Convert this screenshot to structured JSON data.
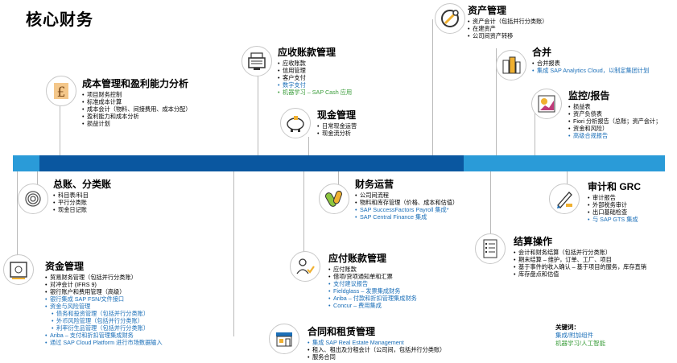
{
  "title": "核心财务",
  "modules": {
    "cost": {
      "title": "成本管理和盈利能力分析",
      "icon": "pound-icon",
      "items": [
        "项目财务控制",
        "标准成本计算",
        "成本会计（物料、间接费用、成本分配）",
        "盈利能力和成本分析",
        "损益计划"
      ]
    },
    "ar": {
      "title": "应收账款管理",
      "icon": "cash-register-icon",
      "items": [
        "应收账款",
        "信用管理",
        "客户支付",
        "数字支付",
        "机器学习 – SAP Cash 应用"
      ]
    },
    "cash": {
      "title": "现金管理",
      "icon": "piggy-bank-icon",
      "items": [
        "日常现金运营",
        "现金流分析"
      ]
    },
    "asset": {
      "title": "资产管理",
      "icon": "wrench-icon",
      "items": [
        "资产会计（包括并行分类账）",
        "在建资产",
        "公司间资产转移"
      ]
    },
    "consol": {
      "title": "合并",
      "icon": "buildings-icon",
      "items": [
        "合并报表",
        "集成 SAP Analytics Cloud，以制定集团计划"
      ]
    },
    "monitor": {
      "title": "监控/报告",
      "icon": "report-icon",
      "items": [
        "损益表",
        "资产负债表",
        "Fiori 分析报告（总账；资产会计；",
        "资金和风险）",
        "高级合规报告"
      ]
    },
    "gl": {
      "title": "总账、分类账",
      "icon": "fingerprint-icon",
      "items": [
        "科目表/科目",
        "平行分类账",
        "现金日记账"
      ]
    },
    "fin_ops": {
      "title": "财务运营",
      "icon": "pills-icon",
      "items": [
        "公司间流程",
        "物料和库存管理（价格、成本和估值）",
        "SAP SuccessFactors Payroll 集成*",
        "SAP Central Finance 集成"
      ]
    },
    "audit": {
      "title": "审计和 GRC",
      "icon": "pen-icon",
      "items": [
        "审计报告",
        "外部税务审计",
        "出口基础检查",
        "与 SAP GTS 集成"
      ]
    },
    "closing": {
      "title": "结算操作",
      "icon": "checklist-icon",
      "items": [
        "会计和财务结算（包括并行分类账）",
        "期末结算 – 维护，订单、工厂、项目",
        "基于事件的收入确认 – 基于项目的服务，库存直销",
        "库存盘点和估值"
      ]
    },
    "treasury": {
      "title": "资金管理",
      "icon": "safe-icon",
      "items": [
        "贸易财务管理（包括并行分类账）",
        "对冲会计 (IFRS 9)",
        "银行账户和费用管理（高级）",
        "银行集成 SAP FSN/文件接口",
        "资金与风险管理",
        "债务和投资管理（包括并行分类账）",
        "外币风险管理（包括并行分类账）",
        "利率衍生品管理（包括并行分类账）",
        "Ariba – 支付和折扣管理集成财务",
        "通过 SAP Cloud Platform 进行市场数据输入"
      ]
    },
    "ap": {
      "title": "应付账款管理",
      "icon": "person-check-icon",
      "items": [
        "应付账款",
        "借项/贷项通知单和汇票",
        "支付建议报告",
        "Fieldglass – 发票集成财务",
        "Ariba – 付款和折扣管理集成财务",
        "Concur – 费用集成"
      ]
    },
    "lease": {
      "title": "合同和租赁管理",
      "icon": "store-icon",
      "items": [
        "集成 SAP Real Estate Management",
        "租入、租出及分租会计（公司间，包括并行分类账）",
        "服务合同"
      ]
    }
  },
  "legend": {
    "title": "关键词：",
    "blue": "集成/附加组件",
    "green": "机器学习/人工智能"
  },
  "colors": {
    "band_dark": "#0a57a0",
    "band_light": "#2a9bd8",
    "integration": "#1b6fb8",
    "ml": "#3b9d3b"
  }
}
